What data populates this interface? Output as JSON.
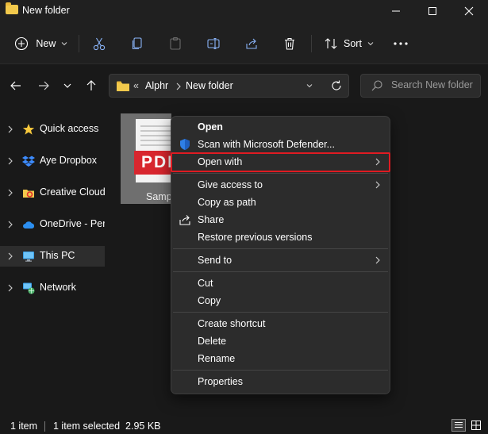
{
  "window": {
    "title": "New folder"
  },
  "toolbar": {
    "new_label": "New",
    "sort_label": "Sort"
  },
  "address": {
    "breadcrumb_overflow": "«",
    "crumbs": [
      "Alphr",
      "New folder"
    ]
  },
  "search": {
    "placeholder": "Search New folder"
  },
  "sidebar": {
    "items": [
      {
        "label": "Quick access",
        "icon": "star-icon"
      },
      {
        "label": "Aye Dropbox",
        "icon": "dropbox-icon"
      },
      {
        "label": "Creative Cloud Files",
        "icon": "creative-cloud-icon"
      },
      {
        "label": "OneDrive - Personal",
        "icon": "onedrive-icon"
      },
      {
        "label": "This PC",
        "icon": "monitor-icon",
        "selected": true
      },
      {
        "label": "Network",
        "icon": "network-icon"
      }
    ]
  },
  "file": {
    "name": "Sample",
    "badge": "PDF"
  },
  "context_menu": {
    "groups": [
      [
        {
          "label": "Open",
          "bold": true
        },
        {
          "label": "Scan with Microsoft Defender...",
          "icon": "shield-icon"
        },
        {
          "label": "Open with",
          "submenu": true,
          "highlighted": true
        }
      ],
      [
        {
          "label": "Give access to",
          "submenu": true
        },
        {
          "label": "Copy as path"
        },
        {
          "label": "Share",
          "icon": "share-icon"
        },
        {
          "label": "Restore previous versions"
        }
      ],
      [
        {
          "label": "Send to",
          "submenu": true
        }
      ],
      [
        {
          "label": "Cut"
        },
        {
          "label": "Copy"
        }
      ],
      [
        {
          "label": "Create shortcut"
        },
        {
          "label": "Delete"
        },
        {
          "label": "Rename"
        }
      ],
      [
        {
          "label": "Properties"
        }
      ]
    ]
  },
  "status": {
    "item_count": "1 item",
    "selection": "1 item selected  2.95 KB"
  },
  "colors": {
    "highlight": "#e01b22",
    "folder": "#f2c94c",
    "pdf_red": "#d8262e"
  }
}
